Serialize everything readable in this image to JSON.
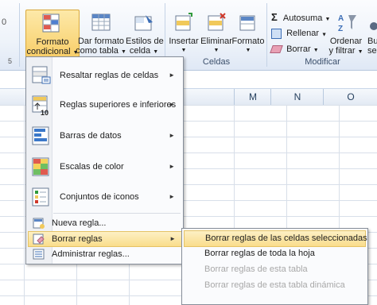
{
  "ribbon": {
    "conditional_format": {
      "line1": "Formato",
      "line2": "condicional"
    },
    "format_as_table": {
      "line1": "Dar formato",
      "line2": "como tabla"
    },
    "cell_styles": {
      "line1": "Estilos de",
      "line2": "celda"
    },
    "insert": {
      "label": "Insertar"
    },
    "delete": {
      "label": "Eliminar"
    },
    "format": {
      "label": "Formato"
    },
    "autosum": "Autosuma",
    "fill": "Rellenar",
    "clear": "Borrar",
    "sort_filter": {
      "line1": "Ordenar",
      "line2": "y filtrar"
    },
    "find_select": {
      "line1": "Buscar y",
      "line2": "seleccionar"
    },
    "group_cells": "Celdas",
    "group_modify": "Modificar",
    "left_stub_top": "0",
    "left_stub_bottom": "5"
  },
  "columns": [
    "M",
    "N",
    "O"
  ],
  "menu": {
    "items": [
      {
        "label": "Resaltar reglas de celdas",
        "has_submenu": true,
        "icon": "highlight-rules-icon"
      },
      {
        "label": "Reglas superiores e inferiores",
        "has_submenu": true,
        "icon": "top-bottom-rules-icon"
      },
      {
        "label": "Barras de datos",
        "has_submenu": true,
        "icon": "data-bars-icon"
      },
      {
        "label": "Escalas de color",
        "has_submenu": true,
        "icon": "color-scales-icon"
      },
      {
        "label": "Conjuntos de iconos",
        "has_submenu": true,
        "icon": "icon-sets-icon"
      },
      {
        "label": "Nueva regla...",
        "has_submenu": false,
        "icon": "new-rule-icon"
      },
      {
        "label": "Borrar reglas",
        "has_submenu": true,
        "icon": "clear-rules-icon",
        "highlighted": true
      },
      {
        "label": "Administrar reglas...",
        "has_submenu": false,
        "icon": "manage-rules-icon"
      }
    ]
  },
  "submenu": {
    "items": [
      {
        "label": "Borrar reglas de las celdas seleccionadas",
        "enabled": true,
        "highlighted": true
      },
      {
        "label": "Borrar reglas de toda la hoja",
        "enabled": true
      },
      {
        "label": "Borrar reglas de esta tabla",
        "enabled": false
      },
      {
        "label": "Borrar reglas de esta tabla dinámica",
        "enabled": false
      }
    ]
  },
  "colors": {
    "highlight": "#f9dd8b",
    "ribbon_bg": "#dfe8f5",
    "disabled_text": "#a8a8a8"
  }
}
